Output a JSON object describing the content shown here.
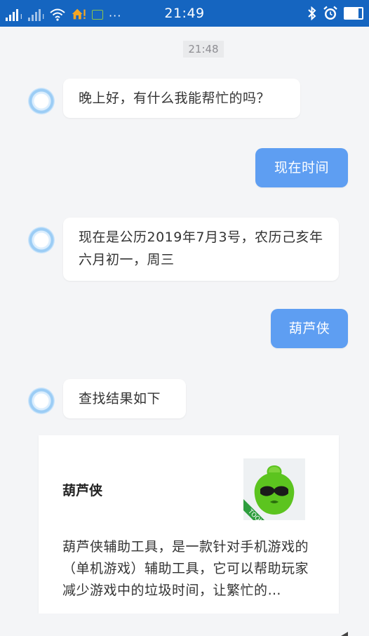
{
  "status_bar": {
    "time": "21:49",
    "signal1_label": "l",
    "signal2_label": "l",
    "more_glyph": "···",
    "icons": [
      "signal-icon",
      "signal-icon",
      "wifi-icon",
      "home-alert-icon",
      "message-icon",
      "more-icon",
      "bluetooth-icon",
      "alarm-icon"
    ],
    "accent": "#1565c0"
  },
  "chat": {
    "timestamp": "21:48",
    "messages": [
      {
        "from": "bot",
        "text": "晚上好，有什么我能帮忙的吗？"
      },
      {
        "from": "user",
        "text": "现在时间"
      },
      {
        "from": "bot",
        "text": "现在是公历2019年7月3号，农历己亥年六月初一，周三"
      },
      {
        "from": "user",
        "text": "葫芦侠"
      },
      {
        "from": "bot",
        "text": "查找结果如下"
      }
    ],
    "user_bubble_color": "#5e9ef2"
  },
  "result_card": {
    "title": "葫芦侠",
    "image_icon": "huluxia-app-icon",
    "image_badge": "TOOL",
    "description": "葫芦侠辅助工具，是一款针对手机游戏的（单机游戏）辅助工具，它可以帮助玩家减少游戏中的垃圾时间，让繁忙的…"
  }
}
